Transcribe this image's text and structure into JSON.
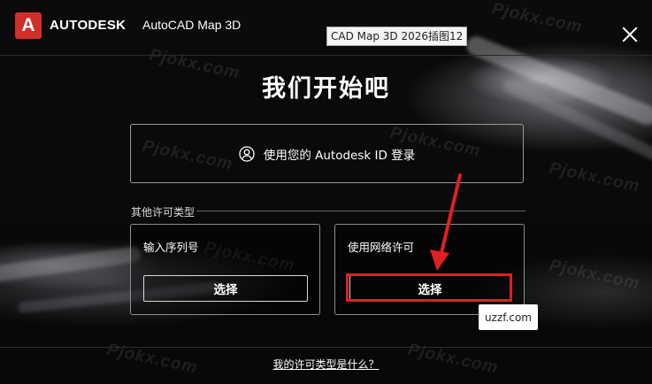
{
  "titlebar": {
    "brand": "AUTODESK",
    "product": "AutoCAD Map 3D",
    "logo_letter": "A",
    "tooltip": "CAD Map 3D 2026插图12"
  },
  "main": {
    "headline": "我们开始吧",
    "signin_label": "使用您的 Autodesk ID 登录",
    "other_license_label": "其他许可类型",
    "cards": [
      {
        "title": "输入序列号",
        "button": "选择"
      },
      {
        "title": "使用网络许可",
        "button": "选择"
      }
    ]
  },
  "footer": {
    "link": "我的许可类型是什么？"
  },
  "watermark": {
    "badge": "uzzf.com",
    "tile_text": "Pjokx.com"
  },
  "colors": {
    "accent_red": "#d0302a",
    "highlight_red": "#e02020",
    "background": "#0a0a0a"
  }
}
